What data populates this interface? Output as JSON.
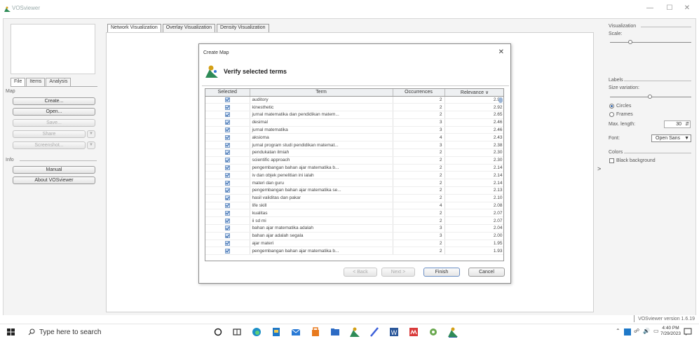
{
  "window": {
    "title": "VOSviewer",
    "minimize": "—",
    "maximize": "☐",
    "close": "✕"
  },
  "left_panel": {
    "tabs": [
      "File",
      "Items",
      "Analysis"
    ],
    "map_section": "Map",
    "buttons": {
      "create": "Create...",
      "open": "Open...",
      "save": "Save...",
      "share": "Share",
      "screenshot": "Screenshot..."
    },
    "info_section": "Info",
    "info_buttons": {
      "manual": "Manual",
      "about": "About VOSviewer"
    }
  },
  "main_tabs": [
    "Network Visualization",
    "Overlay Visualization",
    "Density Visualization"
  ],
  "dialog": {
    "title": "Create Map",
    "close": "✕",
    "heading": "Verify selected terms",
    "columns": [
      "Selected",
      "Term",
      "Occurrences",
      "Relevance ∨"
    ],
    "rows": [
      {
        "term": "auditory",
        "occurrences": "2",
        "relevance": "2.97"
      },
      {
        "term": "kinesthetic",
        "occurrences": "2",
        "relevance": "2.92"
      },
      {
        "term": "jurnal matematika dan pendidikan matem...",
        "occurrences": "2",
        "relevance": "2.65"
      },
      {
        "term": "desimal",
        "occurrences": "3",
        "relevance": "2.46"
      },
      {
        "term": "jurnal matematika",
        "occurrences": "3",
        "relevance": "2.46"
      },
      {
        "term": "aksioma",
        "occurrences": "4",
        "relevance": "2.43"
      },
      {
        "term": "jurnal program studi pendidikan matemat...",
        "occurrences": "3",
        "relevance": "2.38"
      },
      {
        "term": "pendukatan ilmiah",
        "occurrences": "2",
        "relevance": "2.30"
      },
      {
        "term": "scientific approach",
        "occurrences": "2",
        "relevance": "2.30"
      },
      {
        "term": "pengembangan bahan ajar matematika b...",
        "occurrences": "2",
        "relevance": "2.14"
      },
      {
        "term": "iv dan objek penelitian ini ialah",
        "occurrences": "2",
        "relevance": "2.14"
      },
      {
        "term": "materi dan guru",
        "occurrences": "2",
        "relevance": "2.14"
      },
      {
        "term": "pengembangan bahan ajar matematika se...",
        "occurrences": "2",
        "relevance": "2.13"
      },
      {
        "term": "hasil validitas dan pakar",
        "occurrences": "2",
        "relevance": "2.10"
      },
      {
        "term": "life skill",
        "occurrences": "4",
        "relevance": "2.08"
      },
      {
        "term": "kualitas",
        "occurrences": "2",
        "relevance": "2.07"
      },
      {
        "term": "ii sd mi",
        "occurrences": "2",
        "relevance": "2.07"
      },
      {
        "term": "bahan ajar matematika adalah",
        "occurrences": "3",
        "relevance": "2.04"
      },
      {
        "term": "bahan ajar adalah segala",
        "occurrences": "3",
        "relevance": "2.00"
      },
      {
        "term": "ajar materi",
        "occurrences": "2",
        "relevance": "1.95"
      },
      {
        "term": "pengembangan bahan ajar matematika b...",
        "occurrences": "2",
        "relevance": "1.93"
      }
    ],
    "buttons": {
      "back": "< Back",
      "next": "Next >",
      "finish": "Finish",
      "cancel": "Cancel"
    }
  },
  "right_panel": {
    "visualization": "Visualization",
    "scale": "Scale:",
    "labels": "Labels",
    "size_variation": "Size variation:",
    "circles": "Circles",
    "frames": "Frames",
    "max_length_label": "Max. length:",
    "max_length_value": "30",
    "font_label": "Font:",
    "font_value": "Open Sans",
    "colors": "Colors",
    "black_background": "Black background",
    "expand": ">"
  },
  "status": {
    "version": "VOSviewer version 1.6.19"
  },
  "taskbar": {
    "search_placeholder": "Type here to search",
    "time": "4:40 PM",
    "date": "7/29/2023"
  },
  "colors": {
    "accent": "#2b5fa5",
    "frame": "#f4f4f4"
  }
}
